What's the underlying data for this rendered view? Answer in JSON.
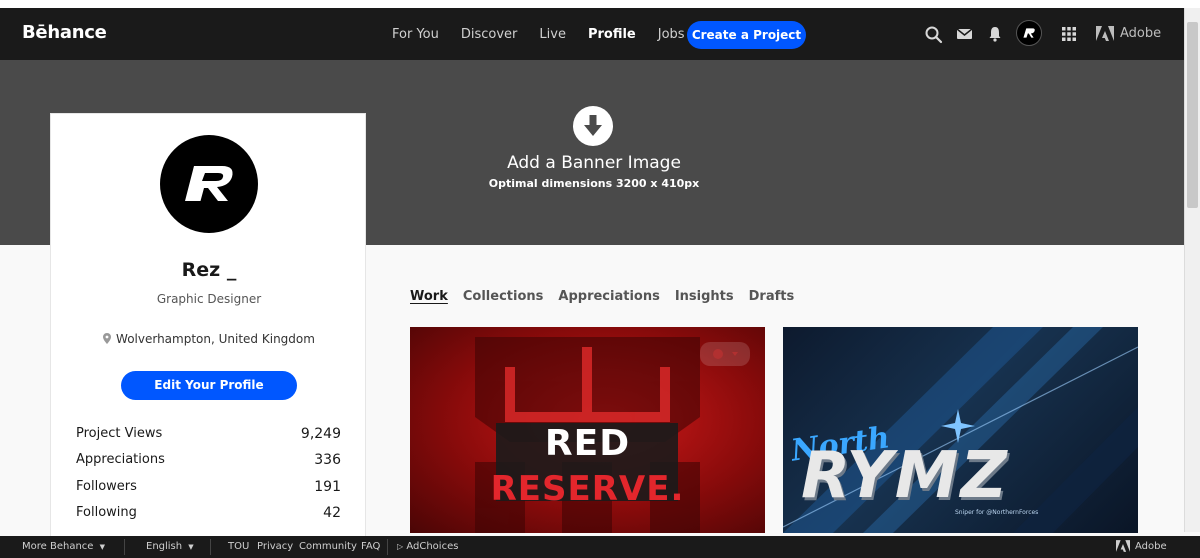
{
  "navbar": {
    "logo": "Bēhance",
    "links": [
      "For You",
      "Discover",
      "Live",
      "Profile",
      "Jobs"
    ],
    "active_link": "Profile",
    "create_button": "Create a Project",
    "adobe_label": "Adobe"
  },
  "banner": {
    "title": "Add a Banner Image",
    "subtitle": "Optimal dimensions 3200 x 410px"
  },
  "profile": {
    "name": "Rez _",
    "occupation": "Graphic Designer",
    "location": "Wolverhampton, United Kingdom",
    "edit_button": "Edit Your Profile",
    "stats": [
      {
        "label": "Project Views",
        "value": "9,249"
      },
      {
        "label": "Appreciations",
        "value": "336"
      },
      {
        "label": "Followers",
        "value": "191"
      },
      {
        "label": "Following",
        "value": "42"
      }
    ]
  },
  "tabs": [
    "Work",
    "Collections",
    "Appreciations",
    "Insights",
    "Drafts"
  ],
  "active_tab": "Work",
  "projects": [
    {
      "line1": "RED",
      "line2": "RESERVE."
    },
    {
      "word1": "North",
      "word2": "RYMZ",
      "caption": "Sniper for @NorthernForces"
    }
  ],
  "footer": {
    "more": "More Behance",
    "language": "English",
    "links": [
      "TOU",
      "Privacy",
      "Community",
      "FAQ"
    ],
    "adchoices": "AdChoices",
    "adobe_label": "Adobe"
  },
  "colors": {
    "accent": "#0057ff",
    "nav_bg": "#1a1a1a",
    "banner_bg": "#4a4a4a"
  }
}
